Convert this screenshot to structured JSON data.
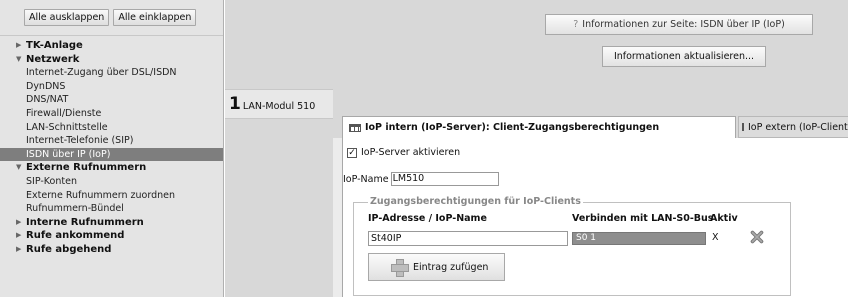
{
  "sidebar": {
    "expand_all": "Alle ausklappen",
    "collapse_all": "Alle einklappen",
    "items": [
      {
        "type": "cat",
        "label": "TK-Anlage",
        "icon": "triangle-right"
      },
      {
        "type": "cat",
        "label": "Netzwerk",
        "icon": "triangle-down"
      },
      {
        "type": "sub",
        "label": "Internet-Zugang über DSL/ISDN"
      },
      {
        "type": "sub",
        "label": "DynDNS"
      },
      {
        "type": "sub",
        "label": "DNS/NAT"
      },
      {
        "type": "sub",
        "label": "Firewall/Dienste"
      },
      {
        "type": "sub",
        "label": "LAN-Schnittstelle"
      },
      {
        "type": "sub",
        "label": "Internet-Telefonie (SIP)"
      },
      {
        "type": "sub",
        "label": "ISDN über IP (IoP)",
        "active": true
      },
      {
        "type": "cat",
        "label": "Externe Rufnummern",
        "icon": "triangle-down"
      },
      {
        "type": "sub",
        "label": "SIP-Konten"
      },
      {
        "type": "sub",
        "label": "Externe Rufnummern zuordnen"
      },
      {
        "type": "sub",
        "label": "Rufnummern-Bündel"
      },
      {
        "type": "cat",
        "label": "Interne Rufnummern",
        "icon": "triangle-right"
      },
      {
        "type": "cat",
        "label": "Rufe ankommend",
        "icon": "triangle-right"
      },
      {
        "type": "cat",
        "label": "Rufe abgehend",
        "icon": "triangle-right"
      }
    ]
  },
  "header": {
    "info_icon": "?",
    "info_label": "Informationen zur Seite: ISDN über IP (IoP)",
    "refresh_label": "Informationen aktualisieren..."
  },
  "module": {
    "number": "1",
    "label": "LAN-Modul 510"
  },
  "tabs": {
    "active": "IoP intern (IoP-Server): Client-Zugangsberechtigungen",
    "inactive": "IoP extern (IoP-Client)"
  },
  "form": {
    "server_checkbox_mark": "✓",
    "server_checkbox_label": "IoP-Server aktivieren",
    "name_label": "IoP-Name",
    "name_value": "LM510",
    "group_legend": "Zugangsberechtigungen für IoP-Clients",
    "col_ip": "IP-Adresse / IoP-Name",
    "col_bus": "Verbinden mit LAN-S0-Bus",
    "col_active": "Aktiv",
    "row_ip": "St40IP",
    "row_bus": "S0 1",
    "row_active": "X",
    "add_label": "Eintrag zufügen"
  }
}
